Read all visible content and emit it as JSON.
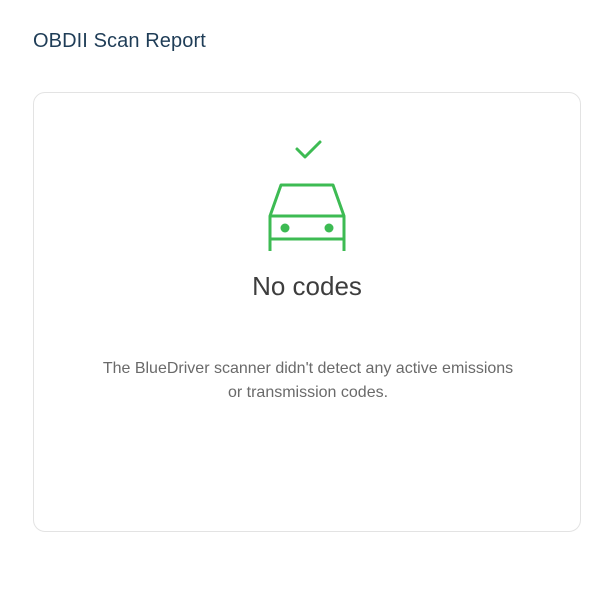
{
  "header": {
    "title": "OBDII Scan Report"
  },
  "result": {
    "icon": "car-check-icon",
    "title": "No codes",
    "description": "The BlueDriver scanner didn't detect any active emissions or transmission codes."
  },
  "colors": {
    "title": "#1f3d57",
    "icon": "#3dbb53",
    "card_border": "#e3e3e3",
    "body_text": "#6a6a6a"
  }
}
